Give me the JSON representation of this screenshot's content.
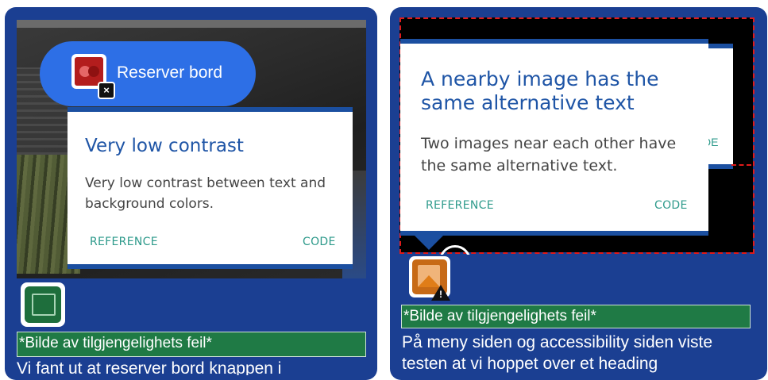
{
  "left_card": {
    "button_label": "Reserver bord",
    "tooltip": {
      "title": "Very low contrast",
      "description": "Very low contrast between text and background colors.",
      "reference": "REFERENCE",
      "code": "CODE"
    },
    "label": "*Bilde av tilgjengelighets feil*",
    "text": "Vi fant ut at reserver bord knappen i"
  },
  "right_card": {
    "tooltip": {
      "title": "A nearby image has the same alternative text",
      "description": "Two images near each other have the same alternative text.",
      "reference": "REFERENCE",
      "code": "CODE"
    },
    "back_card_fragment": "DE",
    "label": "*Bilde av tilgjengelighets feil*",
    "text": "På meny siden og accessibility siden viste testen at vi hoppet over et heading"
  },
  "icons": {
    "contrast": "contrast-error-icon",
    "close": "close-icon",
    "image_ok": "image-icon",
    "image_warning": "image-warning-icon",
    "warning": "warning-icon"
  },
  "colors": {
    "card_bg": "#1b3f92",
    "pill": "#2d6fe6",
    "tooltip_title": "#1f55a6",
    "link": "#2e9a8b",
    "label_bg": "#1f7a45",
    "error_outline": "#e01a1a"
  }
}
